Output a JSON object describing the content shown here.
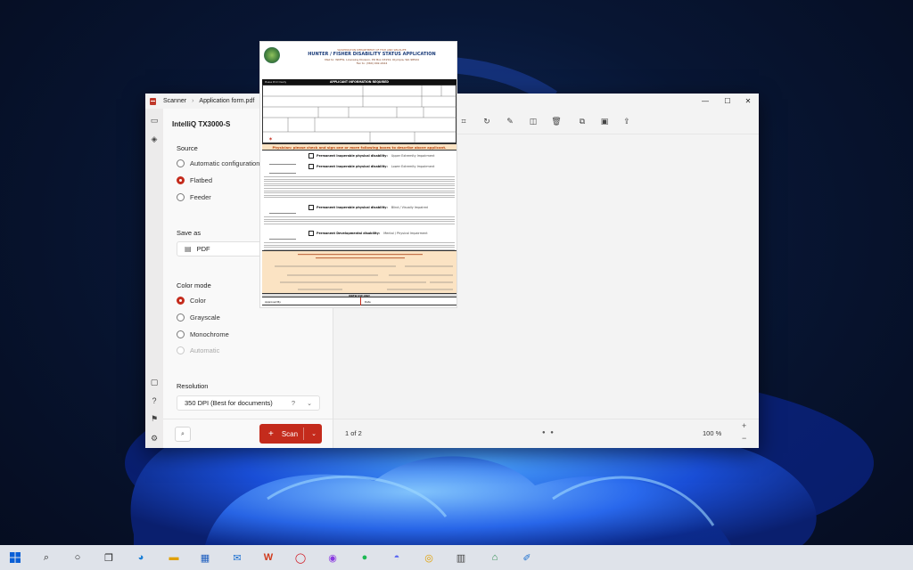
{
  "window": {
    "app_name": "Scanner",
    "breadcrumb_sep": "›",
    "file_name": "Application form.pdf",
    "minimize": "—",
    "maximize": "☐",
    "close": "✕"
  },
  "scanner": {
    "device_name": "IntelliQ TX3000-S",
    "help": "?",
    "chevron": "⌄",
    "source": {
      "title": "Source",
      "options": [
        "Automatic configuration",
        "Flatbed",
        "Feeder"
      ],
      "selected": "Flatbed"
    },
    "save_as": {
      "title": "Save as",
      "value": "PDF",
      "help": "?"
    },
    "color_mode": {
      "title": "Color mode",
      "options": [
        "Color",
        "Grayscale",
        "Monochrome",
        "Automatic"
      ],
      "selected": "Color",
      "disabled": [
        "Automatic"
      ]
    },
    "resolution": {
      "title": "Resolution",
      "value": "350 DPI (Best for documents)",
      "help": "?"
    },
    "scan_button": "Scan"
  },
  "viewer": {
    "page_indicator": "1 of 2",
    "zoom": "100 %",
    "zoom_in": "+",
    "zoom_out": "−",
    "tools": [
      "crop-icon",
      "rotate-icon",
      "markup-icon",
      "flip-icon",
      "delete-icon",
      "copy-icon",
      "save-icon",
      "share-icon"
    ]
  },
  "document": {
    "agency": "WASHINGTON DEPARTMENT OF FISH AND WILDLIFE",
    "title": "HUNTER / FISHER DISABILITY STATUS APPLICATION",
    "address": "Mail to:  WDFW, Licensing Division, PO Box 43154, Olympia, WA  98504",
    "fax": "Fax to:  (360) 902-2444",
    "applicant_header": "APPLICANT INFORMATION REQUIRED",
    "print_clearly": "Please Print Clearly",
    "physician_header": "Physician:  please check and sign one or more following boxes to describe above applicant.",
    "options": [
      {
        "bold": "Permanent Inoperable physical disability:",
        "detail": "Upper Extremity Impairment"
      },
      {
        "bold": "Permanent Inoperable physical disability:",
        "detail": "Lower Extremity Impairment"
      },
      {
        "bold": "Permanent Inoperable physical disability:",
        "detail": "Blind / Visually Impaired"
      },
      {
        "bold": "Permanent Developmental disability:",
        "detail": "Mental / Physical Impairment"
      }
    ],
    "office_use": "WDFW USE ONLY",
    "approved_by": "Approved By",
    "date": "Date"
  }
}
